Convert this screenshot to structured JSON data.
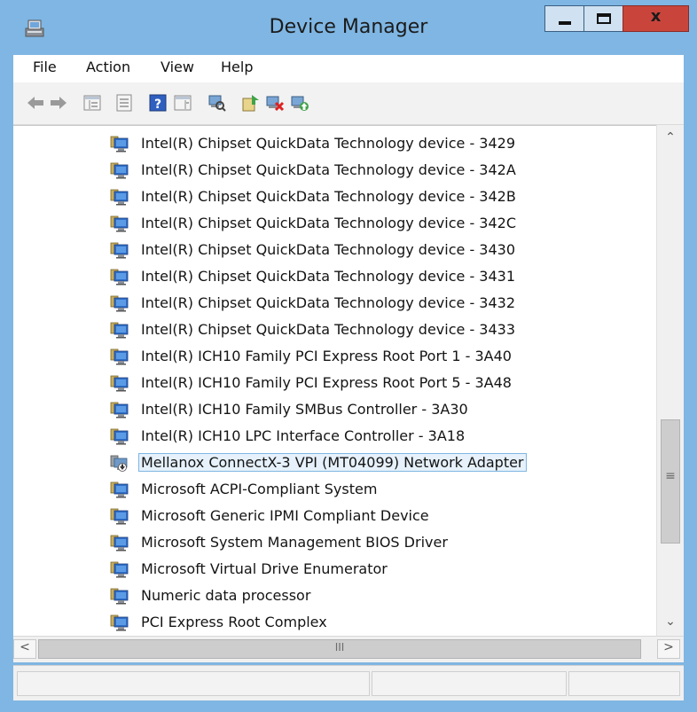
{
  "window": {
    "title": "Device Manager",
    "close_glyph": "x"
  },
  "menu": [
    "File",
    "Action",
    "View",
    "Help"
  ],
  "toolbar": [
    "back-icon",
    "forward-icon",
    "show-hide-tree-icon",
    "properties-icon",
    "help-icon",
    "action-pane-icon",
    "scan-hardware-icon",
    "update-driver-icon",
    "uninstall-device-icon",
    "enable-device-icon"
  ],
  "tree": {
    "items": [
      {
        "label": "Intel(R) Chipset QuickData Technology device - 3429",
        "icon": "system-device-icon"
      },
      {
        "label": "Intel(R) Chipset QuickData Technology device - 342A",
        "icon": "system-device-icon"
      },
      {
        "label": "Intel(R) Chipset QuickData Technology device - 342B",
        "icon": "system-device-icon"
      },
      {
        "label": "Intel(R) Chipset QuickData Technology device - 342C",
        "icon": "system-device-icon"
      },
      {
        "label": "Intel(R) Chipset QuickData Technology device - 3430",
        "icon": "system-device-icon"
      },
      {
        "label": "Intel(R) Chipset QuickData Technology device - 3431",
        "icon": "system-device-icon"
      },
      {
        "label": "Intel(R) Chipset QuickData Technology device - 3432",
        "icon": "system-device-icon"
      },
      {
        "label": "Intel(R) Chipset QuickData Technology device - 3433",
        "icon": "system-device-icon"
      },
      {
        "label": "Intel(R) ICH10 Family PCI Express Root Port 1 - 3A40",
        "icon": "system-device-icon"
      },
      {
        "label": "Intel(R) ICH10 Family PCI Express Root Port 5 - 3A48",
        "icon": "system-device-icon"
      },
      {
        "label": "Intel(R) ICH10 Family SMBus Controller - 3A30",
        "icon": "system-device-icon"
      },
      {
        "label": "Intel(R) ICH10 LPC Interface Controller - 3A18",
        "icon": "system-device-icon"
      },
      {
        "label": "Mellanox ConnectX-3 VPI (MT04099) Network Adapter",
        "icon": "disabled-device-icon",
        "selected": true
      },
      {
        "label": "Microsoft ACPI-Compliant System",
        "icon": "system-device-icon"
      },
      {
        "label": "Microsoft Generic IPMI Compliant Device",
        "icon": "system-device-icon"
      },
      {
        "label": "Microsoft System Management BIOS Driver",
        "icon": "system-device-icon"
      },
      {
        "label": "Microsoft Virtual Drive Enumerator",
        "icon": "system-device-icon"
      },
      {
        "label": "Numeric data processor",
        "icon": "system-device-icon"
      },
      {
        "label": "PCI Express Root Complex",
        "icon": "system-device-icon"
      }
    ]
  },
  "scrollbars": {
    "vertical_grip": "≡",
    "horizontal_grip": "III"
  },
  "colors": {
    "frame": "#7fb6e3",
    "close_button": "#c9453b",
    "selection": "#e6f1fb"
  }
}
